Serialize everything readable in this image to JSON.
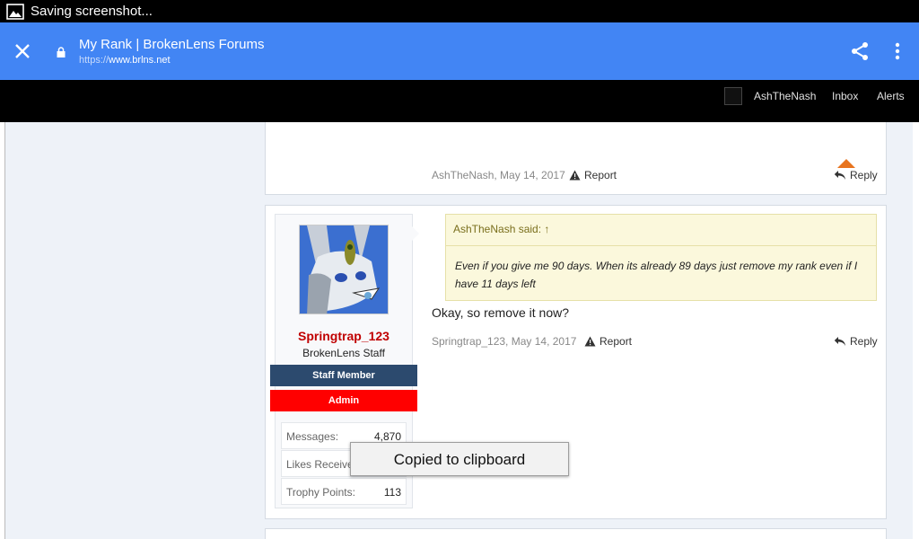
{
  "status_bar": {
    "text": "Saving screenshot..."
  },
  "browser": {
    "title": "My Rank | BrokenLens Forums",
    "url_proto": "https://",
    "url_host": "www.brlns.net",
    "toolbar_color": "#4285f4"
  },
  "forum_nav": {
    "user": "AshTheNash",
    "inbox": "Inbox",
    "alerts": "Alerts"
  },
  "prev_post": {
    "meta": "AshTheNash, May 14, 2017",
    "report_label": "Report",
    "reply_label": "Reply"
  },
  "post": {
    "username": "Springtrap_123",
    "user_title": "BrokenLens Staff",
    "badges": {
      "staff": "Staff Member",
      "admin": "Admin"
    },
    "stats": [
      {
        "label": "Messages:",
        "value": "4,870"
      },
      {
        "label": "Likes Receive",
        "value": ""
      },
      {
        "label": "Trophy Points:",
        "value": "113"
      }
    ],
    "quote": {
      "header": "AshTheNash said: ↑",
      "body": "Even if you give me 90 days. When its already 89 days just remove my rank even if I have 11 days left"
    },
    "message": "Okay, so remove it now?",
    "meta": "Springtrap_123, May 14, 2017",
    "report_label": "Report",
    "reply_label": "Reply"
  },
  "toast": {
    "text": "Copied to clipboard"
  }
}
